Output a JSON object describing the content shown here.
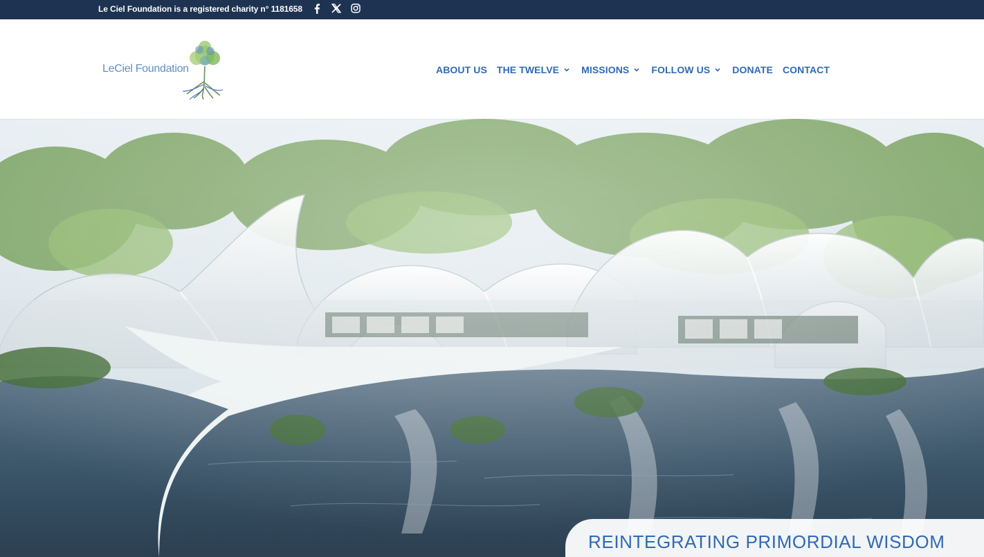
{
  "topbar": {
    "charity_text": "Le Ciel Foundation is a registered charity n° 1181658",
    "social": [
      "facebook-icon",
      "x-icon",
      "instagram-icon"
    ]
  },
  "logo": {
    "text": "LeCiel Foundation"
  },
  "nav": {
    "items": [
      {
        "label": "ABOUT US",
        "dropdown": false
      },
      {
        "label": "THE TWELVE",
        "dropdown": true
      },
      {
        "label": "MISSIONS",
        "dropdown": true
      },
      {
        "label": "FOLLOW US",
        "dropdown": true
      },
      {
        "label": "DONATE",
        "dropdown": false
      },
      {
        "label": "CONTACT",
        "dropdown": false
      }
    ]
  },
  "hero": {
    "banner_title": "REINTEGRATING PRIMORDIAL WISDOM"
  },
  "colors": {
    "topbar_bg": "#1e3352",
    "nav_blue": "#2f6ab4",
    "logo_blue": "#5f8fc7"
  }
}
